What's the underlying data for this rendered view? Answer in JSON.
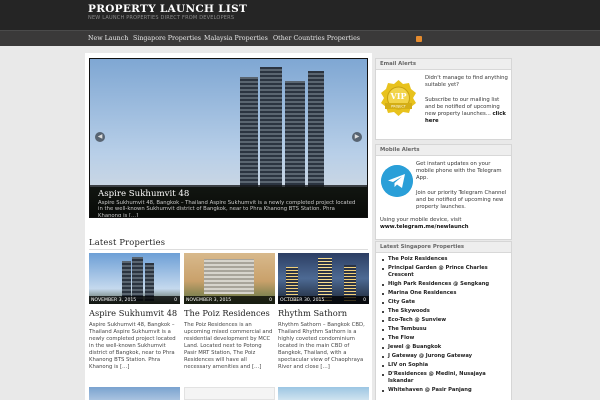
{
  "site": {
    "title": "PROPERTY LAUNCH LIST",
    "tagline": "NEW LAUNCH PROPERTIES DIRECT FROM DEVELOPERS"
  },
  "nav": {
    "items": [
      {
        "label": "New Launch"
      },
      {
        "label": "Singapore Properties"
      },
      {
        "label": "Malaysia Properties"
      },
      {
        "label": "Other Countries Properties"
      }
    ],
    "rss_icon": "rss-icon"
  },
  "slider": {
    "title": "Aspire Sukhumvit 48",
    "text": "Aspire Sukhumvit 48, Bangkok – Thailand Aspire Sukhumvit is a newly completed project located in the well-known Sukhumvit district of Bangkok, near to Phra Khanong BTS Station. Phra Khanong is [...]",
    "prev_icon": "arrow-left-icon",
    "next_icon": "arrow-right-icon"
  },
  "latest": {
    "heading": "Latest Properties",
    "posts": [
      {
        "date": "NOVEMBER 3, 2015",
        "comments": "0",
        "title": "Aspire Sukhumvit 48",
        "excerpt": "Aspire Sukhumvit 48, Bangkok – Thailand Aspire Sukhumvit is a newly completed project located in the well-known Sukhumvit district of Bangkok, near to Phra Khanong BTS Station. Phra Khanong is […]"
      },
      {
        "date": "NOVEMBER 3, 2015",
        "comments": "0",
        "title": "The Poiz Residences",
        "excerpt": "The Poiz Residences is an upcoming mixed commercial and residential development by MCC Land. Located next to Potong Pasir MRT Station, The Poiz Residences will have all necessary amenities and […]"
      },
      {
        "date": "OCTOBER 30, 2015",
        "comments": "0",
        "title": "Rhythm Sathorn",
        "excerpt": "Rhythm Sathorn – Bangkok CBD, Thailand Rhythm Sathorn is a highly coveted condominium located in the main CBD of Bangkok, Thailand, with a spectacular view of Chaophraya River and close […]"
      }
    ]
  },
  "sidebar": {
    "email": {
      "title": "Email Alerts",
      "text1": "Didn't manage to find anything suitable yet?",
      "text2": "Subscribe to our mailing list and be notified of upcoming new property launches...",
      "link": "click here",
      "badge_label": "VIP",
      "badge_sub": "PROJECT"
    },
    "mobile": {
      "title": "Mobile Alerts",
      "text1": "Get instant updates on your mobile phone with the Telegram App.",
      "text2": "Join our priority Telegram Channel and be notified of upcoming new property launches.",
      "text3": "Using your mobile device, visit",
      "link": "www.telegram.me/newlaunch"
    },
    "singapore": {
      "title": "Latest Singapore Properties",
      "items": [
        "The Poiz Residences",
        "Principal Garden @ Prince Charles Crescent",
        "High Park Residences @ Sengkang",
        "Marina One Residences",
        "City Gate",
        "The Skywoods",
        "Eco-Tech @ Sunview",
        "The Tembusu",
        "The Flow",
        "Jewel @ Buangkok",
        "J Gateway @ Jurong Gateway",
        "LIV on Sophia",
        "D'Residences @ Medini, Nusajaya Iskandar",
        "Whitehaven @ Pasir Panjang"
      ]
    }
  },
  "colors": {
    "header_bg": "#252525",
    "nav_bg": "#3a3939",
    "telegram_blue": "#2a9fd8",
    "badge_yellow": "#e8c21d"
  }
}
